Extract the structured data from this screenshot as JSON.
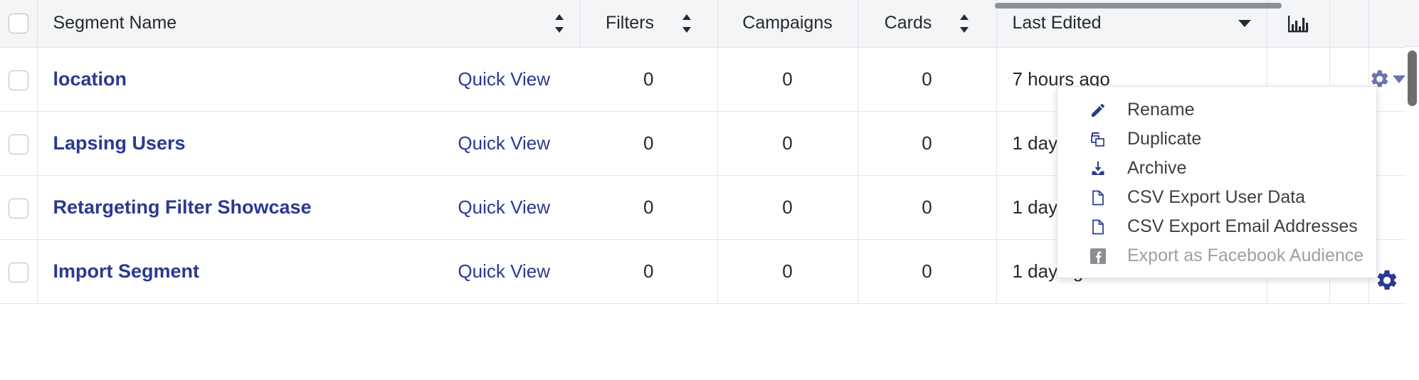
{
  "table": {
    "columns": [
      {
        "key": "select",
        "label": "",
        "sortable": false,
        "icon": "checkbox-icon"
      },
      {
        "key": "name",
        "label": "Segment Name",
        "sortable": true
      },
      {
        "key": "filters",
        "label": "Filters",
        "sortable": true
      },
      {
        "key": "campaigns",
        "label": "Campaigns",
        "sortable": false
      },
      {
        "key": "cards",
        "label": "Cards",
        "sortable": true
      },
      {
        "key": "edited",
        "label": "Last Edited",
        "sortable": false,
        "icon": "caret-down-icon"
      },
      {
        "key": "chart",
        "label": "",
        "sortable": false,
        "icon": "bar-chart-icon"
      },
      {
        "key": "blank",
        "label": "",
        "sortable": false
      },
      {
        "key": "actions",
        "label": "",
        "sortable": false
      }
    ],
    "quick_view_label": "Quick View",
    "rows": [
      {
        "name": "location",
        "quick_view": "Quick View",
        "filters": "0",
        "campaigns": "0",
        "cards": "0",
        "edited": "7 hours ago"
      },
      {
        "name": "Lapsing Users",
        "quick_view": "Quick View",
        "filters": "0",
        "campaigns": "0",
        "cards": "0",
        "edited": "1 day ago"
      },
      {
        "name": "Retargeting Filter Showcase",
        "quick_view": "Quick View",
        "filters": "0",
        "campaigns": "0",
        "cards": "0",
        "edited": "1 day ago"
      },
      {
        "name": "Import Segment",
        "quick_view": "Quick View",
        "filters": "0",
        "campaigns": "0",
        "cards": "0",
        "edited": "1 day ago"
      }
    ]
  },
  "context_menu": {
    "open": true,
    "items": [
      {
        "label": "Rename",
        "icon": "pencil-icon",
        "disabled": false
      },
      {
        "label": "Duplicate",
        "icon": "copy-icon",
        "disabled": false
      },
      {
        "label": "Archive",
        "icon": "archive-icon",
        "disabled": false
      },
      {
        "label": "CSV Export User Data",
        "icon": "file-icon",
        "disabled": false
      },
      {
        "label": "CSV Export Email Addresses",
        "icon": "file-icon",
        "disabled": false
      },
      {
        "label": "Export as Facebook Audience",
        "icon": "facebook-icon",
        "disabled": true
      }
    ]
  },
  "colors": {
    "link": "#2b3990",
    "header_bg": "#f4f5f7",
    "border": "#e4e6ea",
    "gear": "#6b74ab",
    "menu_icon": "#2b3a8f",
    "disabled_text": "#9aa0a6",
    "scrollbar": "#6e6e6e"
  }
}
